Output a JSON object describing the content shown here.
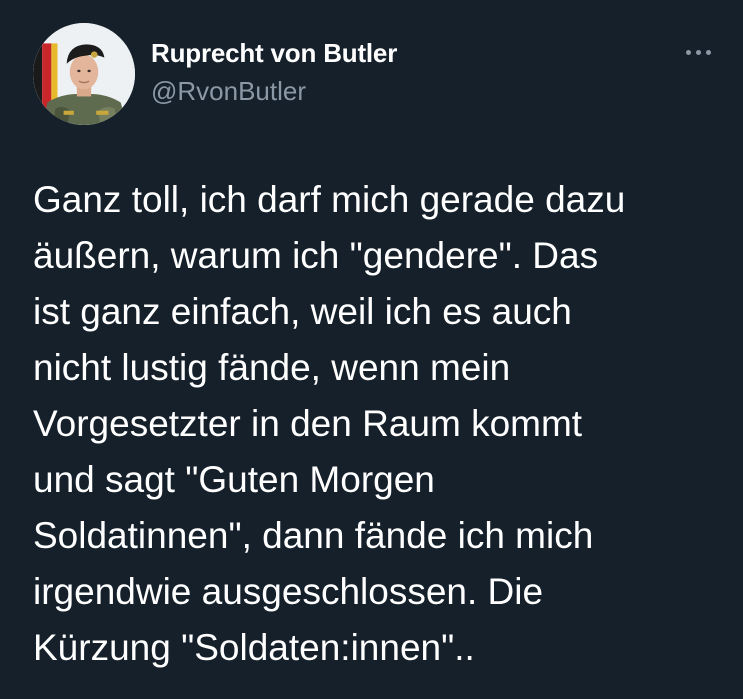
{
  "author": {
    "display_name": "Ruprecht von Butler",
    "handle": "@RvonButler",
    "avatar_icon": "profile-photo-soldier"
  },
  "menu": {
    "icon": "more-horizontal-icon"
  },
  "tweet": {
    "text": "Ganz toll, ich darf mich gerade dazu\näußern, warum ich \"gendere\". Das\nist ganz einfach, weil ich es auch\nnicht lustig fände, wenn mein\nVorgesetzter in den Raum kommt\nund sagt \"Guten Morgen\nSoldatinnen\", dann fände ich mich\nirgendwie ausgeschlossen. Die\nKürzung \"Soldaten:innen\".."
  },
  "colors": {
    "background": "#15202b",
    "primary_text": "#ffffff",
    "secondary_text": "#8b98a5"
  }
}
